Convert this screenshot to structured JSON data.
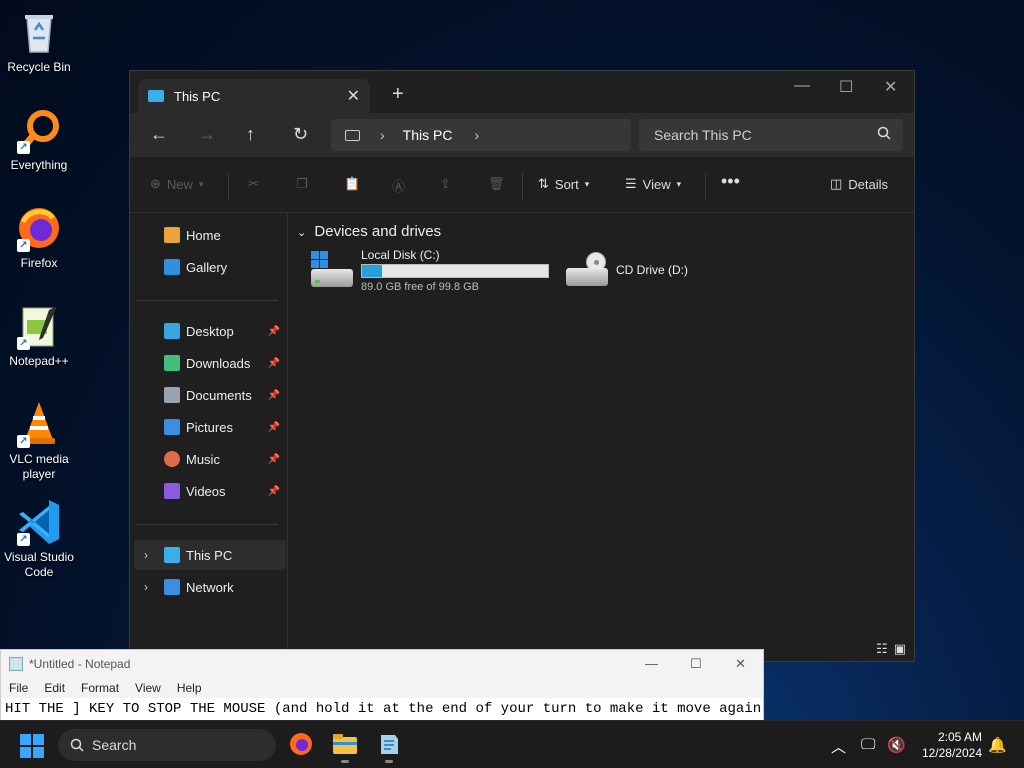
{
  "desktop": {
    "icons": [
      {
        "label": "Recycle Bin",
        "icon": "recycle-bin-icon"
      },
      {
        "label": "Everything",
        "icon": "everything-icon"
      },
      {
        "label": "Firefox",
        "icon": "firefox-icon"
      },
      {
        "label": "Notepad++",
        "icon": "notepad-plus-plus-icon"
      },
      {
        "label": "VLC media player",
        "icon": "vlc-icon"
      },
      {
        "label": "Visual Studio Code",
        "icon": "vscode-icon"
      }
    ]
  },
  "explorer": {
    "tab_title": "This PC",
    "address": {
      "root_icon": "computer-icon",
      "crumb": "This PC"
    },
    "search_placeholder": "Search This PC",
    "toolbar": {
      "new_label": "New",
      "sort_label": "Sort",
      "view_label": "View",
      "details_label": "Details"
    },
    "sidebar": {
      "top": [
        {
          "label": "Home",
          "icon": "home-icon",
          "color": "#e8a53c"
        },
        {
          "label": "Gallery",
          "icon": "gallery-icon",
          "color": "#2f8fe0"
        }
      ],
      "quick_access": [
        {
          "label": "Desktop",
          "icon": "desktop-folder-icon",
          "color": "#35a8e0"
        },
        {
          "label": "Downloads",
          "icon": "downloads-icon",
          "color": "#3fbf7a"
        },
        {
          "label": "Documents",
          "icon": "documents-icon",
          "color": "#9aa4b1"
        },
        {
          "label": "Pictures",
          "icon": "pictures-icon",
          "color": "#3a8fe0"
        },
        {
          "label": "Music",
          "icon": "music-icon",
          "color": "#e06a4a"
        },
        {
          "label": "Videos",
          "icon": "videos-icon",
          "color": "#8a5ae0"
        }
      ],
      "bottom": [
        {
          "label": "This PC",
          "icon": "this-pc-icon",
          "color": "#3ab0e8"
        },
        {
          "label": "Network",
          "icon": "network-icon",
          "color": "#3a8fe0"
        }
      ]
    },
    "content": {
      "section_title": "Devices and drives",
      "drives": [
        {
          "name": "Local Disk (C:)",
          "free_text": "89.0 GB free of 99.8 GB",
          "used_fraction": 0.108
        },
        {
          "name": "CD Drive (D:)"
        }
      ]
    }
  },
  "notepad": {
    "title": "*Untitled - Notepad",
    "menu": [
      "File",
      "Edit",
      "Format",
      "View",
      "Help"
    ],
    "text": "HIT THE ] KEY TO STOP THE MOUSE (and hold it at the end of your turn to make it move again!)"
  },
  "taskbar": {
    "search_label": "Search",
    "time": "2:05 AM",
    "date": "12/28/2024"
  }
}
